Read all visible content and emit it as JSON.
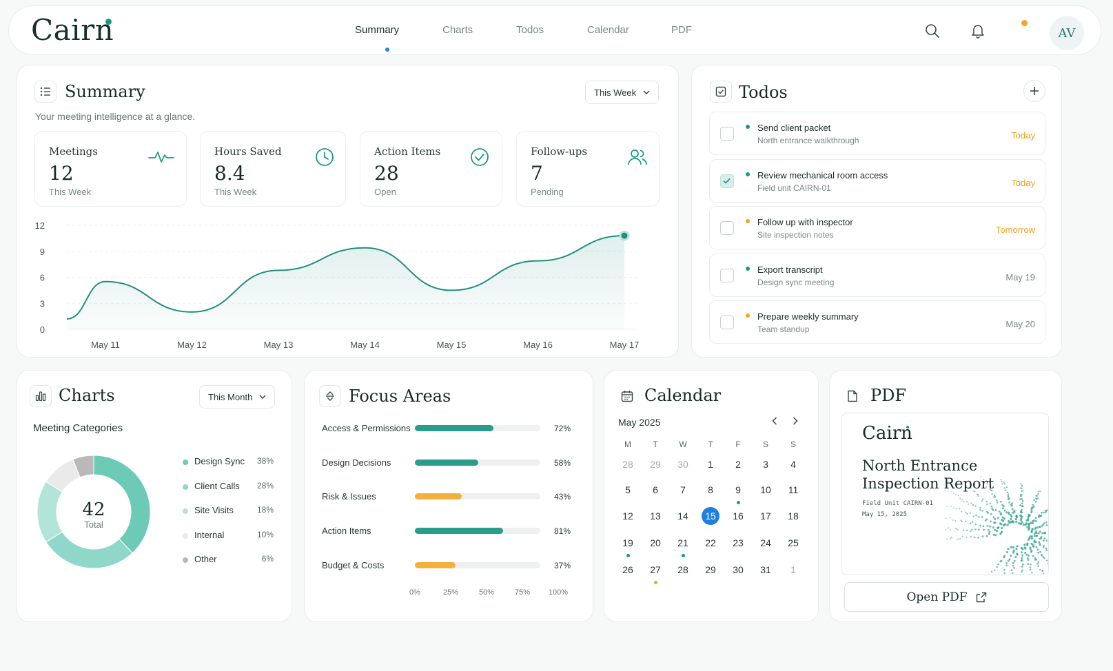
{
  "brand": {
    "name": "Cairn",
    "accent": "#1a9a86"
  },
  "nav": {
    "items": [
      "Summary",
      "Charts",
      "Todos",
      "Calendar",
      "PDF"
    ],
    "active": "Summary"
  },
  "user": {
    "initials": "AV"
  },
  "summary": {
    "title": "Summary",
    "subtitle": "Your meeting intelligence at a glance.",
    "range": "This Week",
    "stats": [
      {
        "label": "Meetings",
        "value": "12",
        "sub": "This Week",
        "icon": "activity-icon"
      },
      {
        "label": "Hours Saved",
        "value": "8.4",
        "sub": "This Week",
        "icon": "clock-icon"
      },
      {
        "label": "Action Items",
        "value": "28",
        "sub": "Open",
        "icon": "check-circle-icon"
      },
      {
        "label": "Follow-ups",
        "value": "7",
        "sub": "Pending",
        "icon": "users-icon"
      }
    ]
  },
  "chart_data": [
    {
      "type": "area",
      "x": [
        "May 11",
        "May 12",
        "May 13",
        "May 14",
        "May 15",
        "May 16",
        "May 17"
      ],
      "y_ticks": [
        "12",
        "9",
        "6",
        "3",
        "0"
      ],
      "ylim": [
        0,
        12
      ],
      "series": [
        {
          "values": [
            5.5,
            2.0,
            6.8,
            9.4,
            4.5,
            7.9,
            10.8
          ]
        }
      ],
      "grid": true,
      "color": "#1f8f7c"
    },
    {
      "type": "pie",
      "title": "Meeting Categories",
      "center_value": "42",
      "center_label": "Total",
      "slices": [
        {
          "name": "Design Sync",
          "value": 38,
          "label": "38%",
          "color": "#6ccab7"
        },
        {
          "name": "Client Calls",
          "value": 28,
          "label": "28%",
          "color": "#8fd8c9"
        },
        {
          "name": "Site Visits",
          "value": 18,
          "label": "18%",
          "color": "#b3e4da"
        },
        {
          "name": "Internal",
          "value": 10,
          "label": "10%",
          "color": "#eaeaea"
        },
        {
          "name": "Other",
          "value": 6,
          "label": "6%",
          "color": "#b9b9b9"
        }
      ]
    },
    {
      "type": "bar",
      "orientation": "horizontal",
      "categories": [
        "Access & Permissions",
        "Design Decisions",
        "Risk & Issues",
        "Action Items",
        "Budget & Costs"
      ],
      "values": [
        72,
        58,
        43,
        81,
        37
      ],
      "labels": [
        "72%",
        "58%",
        "43%",
        "81%",
        "37%"
      ],
      "colors": [
        "#2a9d8a",
        "#2a9d8a",
        "#f5b03c",
        "#2a9d8a",
        "#f5b03c"
      ],
      "x_ticks": [
        "0%",
        "25%",
        "50%",
        "75%",
        "100%"
      ],
      "xlim": [
        0,
        100
      ]
    }
  ],
  "todos": {
    "title": "Todos",
    "items": [
      {
        "title": "Send client packet",
        "sub": "North entrance walkthrough",
        "due": "Today",
        "checked": false,
        "dot": "#1a9a86",
        "due_color": "#f0a020"
      },
      {
        "title": "Review mechanical room access",
        "sub": "Field unit CAIRN-01",
        "due": "Today",
        "checked": true,
        "dot": "#1a9a86",
        "due_color": "#f0a020"
      },
      {
        "title": "Follow up with inspector",
        "sub": "Site inspection notes",
        "due": "Tomorrow",
        "checked": false,
        "dot": "#f5a623",
        "due_color": "#f0a020"
      },
      {
        "title": "Export transcript",
        "sub": "Design sync meeting",
        "due": "May 19",
        "checked": false,
        "dot": "#1a9a86",
        "due_color": "#7b8686"
      },
      {
        "title": "Prepare weekly summary",
        "sub": "Team standup",
        "due": "May 20",
        "checked": false,
        "dot": "#f5a623",
        "due_color": "#7b8686"
      }
    ]
  },
  "charts": {
    "title": "Charts",
    "range": "This Month"
  },
  "focus": {
    "title": "Focus Areas"
  },
  "calendar": {
    "title": "Calendar",
    "month": "May 2025",
    "weekdays": [
      "M",
      "T",
      "W",
      "T",
      "F",
      "S",
      "S"
    ],
    "weeks": [
      [
        "28",
        "29",
        "30",
        "1",
        "2",
        "3",
        "4"
      ],
      [
        "5",
        "6",
        "7",
        "8",
        "9",
        "10",
        "11"
      ],
      [
        "12",
        "13",
        "14",
        "15",
        "16",
        "17",
        "18"
      ],
      [
        "19",
        "20",
        "21",
        "22",
        "23",
        "24",
        "25"
      ],
      [
        "26",
        "27",
        "28",
        "29",
        "30",
        "31",
        "1"
      ]
    ],
    "selected": "15"
  },
  "pdf": {
    "title": "PDF",
    "doc_brand": "Cairn",
    "doc_title_line1": "North Entrance",
    "doc_title_line2": "Inspection Report",
    "doc_meta1": "Field Unit CAIRN-01",
    "doc_meta2": "May 15, 2025",
    "open_label": "Open PDF"
  }
}
